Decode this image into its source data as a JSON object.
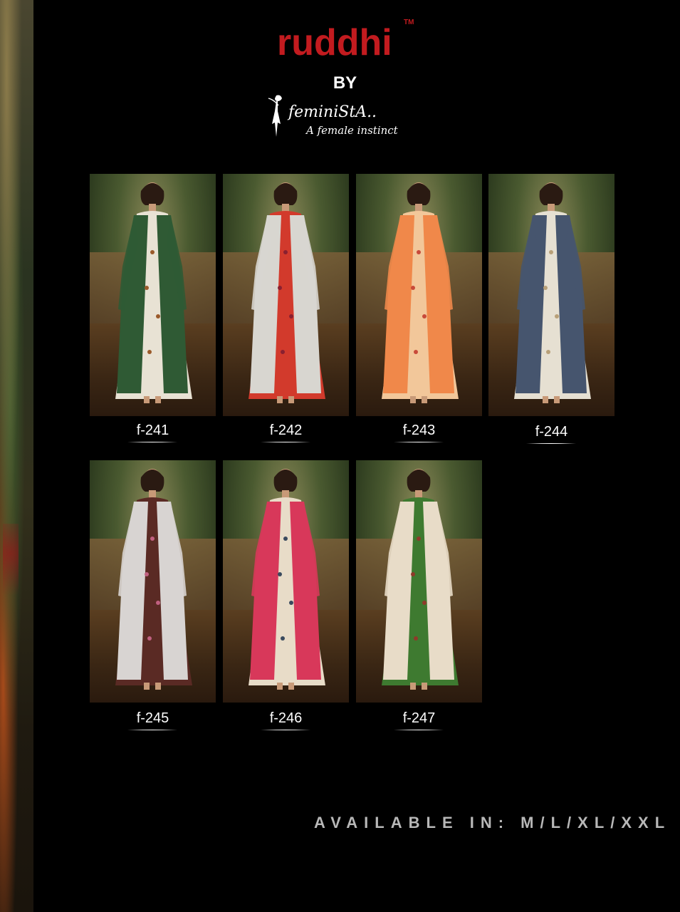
{
  "brand": {
    "name": "ruddhi",
    "trademark": "TM",
    "by": "BY"
  },
  "logo": {
    "name": "feminiStA..",
    "tagline": "A female instinct"
  },
  "products": [
    {
      "code": "f-241",
      "colors": {
        "inner": "#e8e2d4",
        "jacket": "#2f5a34",
        "accent": "#9a5a2a"
      }
    },
    {
      "code": "f-242",
      "colors": {
        "inner": "#d23a2c",
        "jacket": "#d8d6d0",
        "accent": "#8a2030"
      }
    },
    {
      "code": "f-243",
      "colors": {
        "inner": "#f2c79a",
        "jacket": "#f0884a",
        "accent": "#c84a3a"
      }
    },
    {
      "code": "f-244",
      "colors": {
        "inner": "#e6e0d2",
        "jacket": "#46556e",
        "accent": "#b8a078"
      }
    },
    {
      "code": "f-245",
      "colors": {
        "inner": "#5a2a24",
        "jacket": "#d8d4d2",
        "accent": "#c06080"
      }
    },
    {
      "code": "f-246",
      "colors": {
        "inner": "#e8dcc8",
        "jacket": "#d8385a",
        "accent": "#3a4a5e"
      }
    },
    {
      "code": "f-247",
      "colors": {
        "inner": "#3e7a30",
        "jacket": "#e8dcc8",
        "accent": "#8e3a2a"
      }
    }
  ],
  "footer": {
    "available": "AVAILABLE IN: M/L/XL/XXL"
  }
}
